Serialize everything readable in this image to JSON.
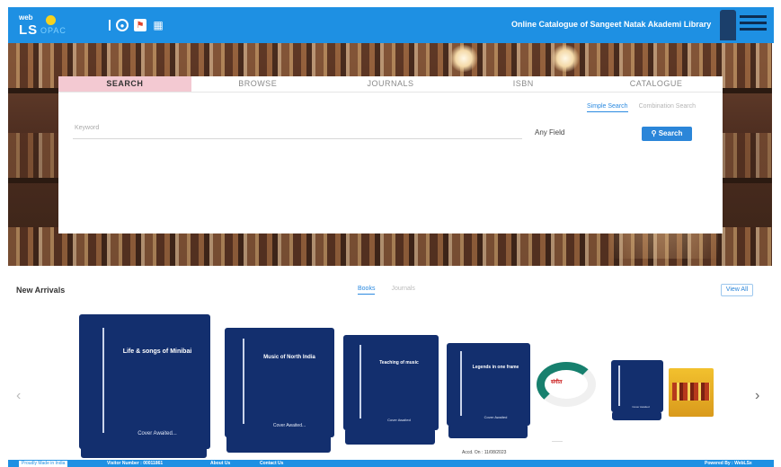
{
  "header": {
    "logo_web": "web",
    "logo_ls": "LS",
    "logo_sub": "OPAC",
    "site_title": "Online Catalogue of Sangeet Natak Akademi Library",
    "icons": [
      "user-icon",
      "flag-icon",
      "grid-icon"
    ]
  },
  "search": {
    "tabs": [
      "SEARCH",
      "BROWSE",
      "JOURNALS",
      "ISBN",
      "CATALOGUE"
    ],
    "active_tab": "SEARCH",
    "mode_simple": "Simple Search",
    "mode_combination": "Combination Search",
    "keyword_placeholder": "Keyword",
    "field_label": "Any Field",
    "search_button": "Search",
    "search_icon": "search-icon"
  },
  "arrivals": {
    "title": "New Arrivals",
    "tab_books": "Books",
    "tab_journals": "Journals",
    "view_all": "View All",
    "books": [
      {
        "title": "Life & songs of Minibai",
        "author": "Cover Awaited..."
      },
      {
        "title": "Music of North India",
        "author": "Cover Awaited..."
      },
      {
        "title": "Teaching of music",
        "author": "Cover Awaited"
      },
      {
        "title": "Legends in one frame",
        "author": "Cover Awaited"
      },
      {
        "title": "",
        "author": "Cover Awaited"
      }
    ],
    "accession_caption": "Accd. On : 11/08/2023"
  },
  "footer": {
    "proudly": "Proudly Made in India",
    "visitors": "Visitor Number : 00011861",
    "about": "About Us",
    "contact": "Contact Us",
    "powered": "Powered By : WebLSx"
  },
  "colors": {
    "header_bg": "#1e90e3",
    "active_tab_bg": "#f3c9d2",
    "book_cover": "#132f6e",
    "search_button": "#2b86d9"
  }
}
